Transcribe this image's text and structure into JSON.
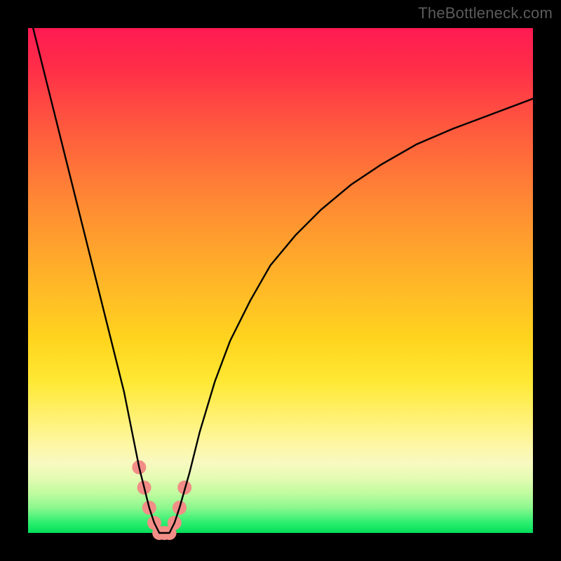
{
  "watermark": "TheBottleneck.com",
  "chart_data": {
    "type": "line",
    "title": "",
    "xlabel": "",
    "ylabel": "",
    "xlim": [
      0,
      100
    ],
    "ylim": [
      0,
      100
    ],
    "grid": false,
    "legend": false,
    "gradient_stops": [
      {
        "pct": 0,
        "color": "#ff1a52"
      },
      {
        "pct": 8,
        "color": "#ff2e48"
      },
      {
        "pct": 20,
        "color": "#ff5a3e"
      },
      {
        "pct": 35,
        "color": "#ff8b33"
      },
      {
        "pct": 50,
        "color": "#ffb528"
      },
      {
        "pct": 62,
        "color": "#ffd51e"
      },
      {
        "pct": 70,
        "color": "#ffe834"
      },
      {
        "pct": 78,
        "color": "#fff27a"
      },
      {
        "pct": 83,
        "color": "#fdf7a8"
      },
      {
        "pct": 86,
        "color": "#f8f9c0"
      },
      {
        "pct": 89,
        "color": "#e6fbb4"
      },
      {
        "pct": 92,
        "color": "#c2fba0"
      },
      {
        "pct": 95,
        "color": "#8cf88e"
      },
      {
        "pct": 98,
        "color": "#2bee6f"
      },
      {
        "pct": 100,
        "color": "#03df59"
      }
    ],
    "series": [
      {
        "name": "bottleneck-curve",
        "color": "#000000",
        "x": [
          1,
          3,
          5,
          7,
          9,
          11,
          13,
          15,
          17,
          19,
          21,
          22,
          23,
          24,
          25,
          26,
          27,
          28,
          29,
          30,
          32,
          34,
          37,
          40,
          44,
          48,
          53,
          58,
          64,
          70,
          77,
          84,
          92,
          100
        ],
        "values": [
          100,
          92,
          84,
          76,
          68,
          60,
          52,
          44,
          36,
          28,
          18,
          13,
          9,
          5,
          2,
          0,
          0,
          0,
          2,
          5,
          12,
          20,
          30,
          38,
          46,
          53,
          59,
          64,
          69,
          73,
          77,
          80,
          83,
          86
        ]
      }
    ],
    "markers": {
      "name": "highlight-points",
      "color": "#f28e87",
      "radius_px": 10,
      "points": [
        {
          "x": 22,
          "y": 13
        },
        {
          "x": 23,
          "y": 9
        },
        {
          "x": 24,
          "y": 5
        },
        {
          "x": 25,
          "y": 2
        },
        {
          "x": 26,
          "y": 0
        },
        {
          "x": 27,
          "y": 0
        },
        {
          "x": 28,
          "y": 0
        },
        {
          "x": 29,
          "y": 2
        },
        {
          "x": 30,
          "y": 5
        },
        {
          "x": 31,
          "y": 9
        }
      ]
    }
  }
}
